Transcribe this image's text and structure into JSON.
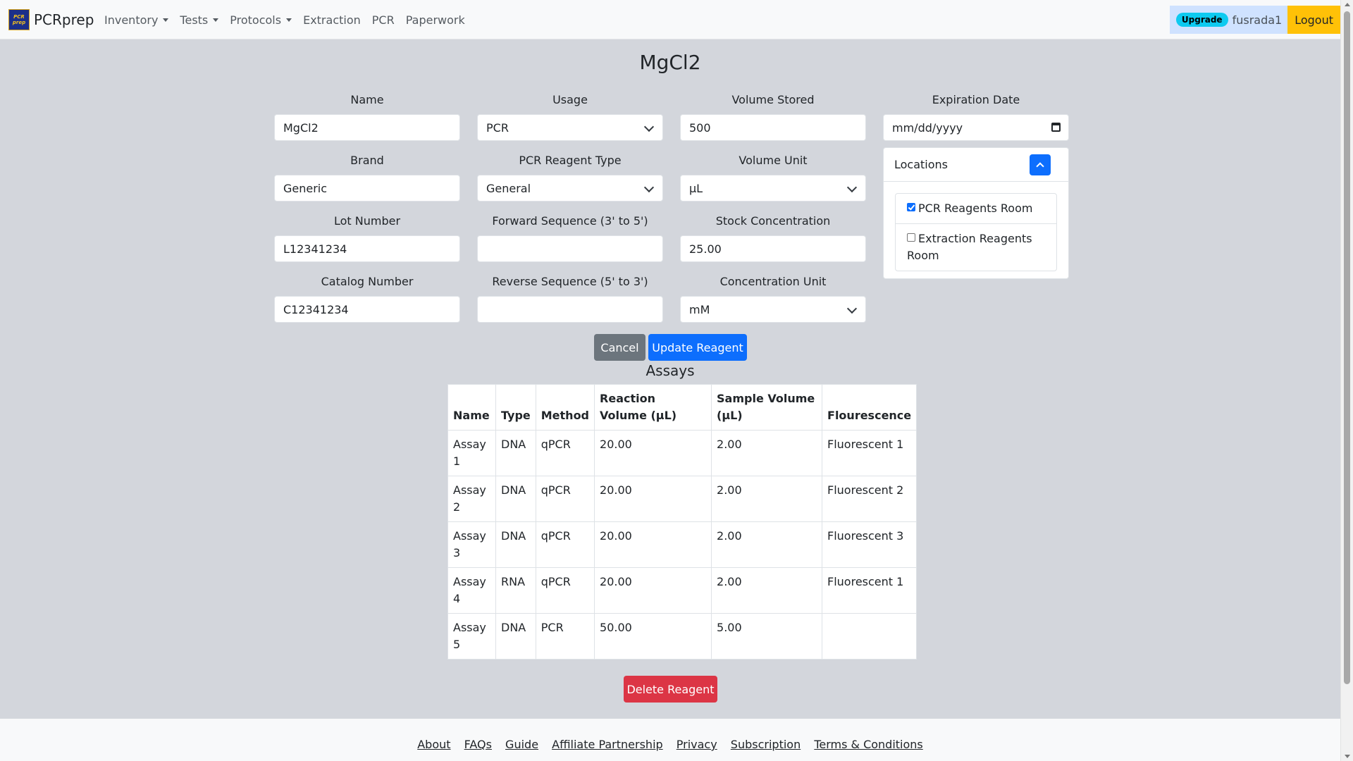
{
  "navbar": {
    "brand": "PCRprep",
    "logo_text": "PCR prep",
    "items": [
      {
        "label": "Inventory",
        "dropdown": true
      },
      {
        "label": "Tests",
        "dropdown": true
      },
      {
        "label": "Protocols",
        "dropdown": true
      },
      {
        "label": "Extraction",
        "dropdown": false
      },
      {
        "label": "PCR",
        "dropdown": false
      },
      {
        "label": "Paperwork",
        "dropdown": false
      }
    ],
    "upgrade_label": "Upgrade",
    "username": "fusrada1",
    "logout_label": "Logout"
  },
  "page": {
    "title": "MgCl2"
  },
  "form": {
    "name": {
      "label": "Name",
      "value": "MgCl2"
    },
    "brand": {
      "label": "Brand",
      "value": "Generic"
    },
    "lot_number": {
      "label": "Lot Number",
      "value": "L12341234"
    },
    "catalog_number": {
      "label": "Catalog Number",
      "value": "C12341234"
    },
    "usage": {
      "label": "Usage",
      "value": "PCR"
    },
    "pcr_reagent_type": {
      "label": "PCR Reagent Type",
      "value": "General"
    },
    "forward_sequence": {
      "label": "Forward Sequence (3' to 5')",
      "value": ""
    },
    "reverse_sequence": {
      "label": "Reverse Sequence (5' to 3')",
      "value": ""
    },
    "volume_stored": {
      "label": "Volume Stored",
      "value": "500"
    },
    "volume_unit": {
      "label": "Volume Unit",
      "value": "µL"
    },
    "stock_concentration": {
      "label": "Stock Concentration",
      "value": "25.00"
    },
    "concentration_unit": {
      "label": "Concentration Unit",
      "value": "mM"
    },
    "expiration_date": {
      "label": "Expiration Date",
      "value": "mm/dd/yyyy"
    }
  },
  "locations": {
    "title": "Locations",
    "items": [
      {
        "label": "PCR Reagents Room",
        "checked": true
      },
      {
        "label": "Extraction Reagents Room",
        "checked": false
      }
    ]
  },
  "actions": {
    "cancel_label": "Cancel",
    "update_label": "Update Reagent",
    "delete_label": "Delete Reagent"
  },
  "assays": {
    "title": "Assays",
    "columns": [
      "Name",
      "Type",
      "Method",
      "Reaction Volume (µL)",
      "Sample Volume (µL)",
      "Flourescence"
    ],
    "rows": [
      [
        "Assay 1",
        "DNA",
        "qPCR",
        "20.00",
        "2.00",
        "Fluorescent 1"
      ],
      [
        "Assay 2",
        "DNA",
        "qPCR",
        "20.00",
        "2.00",
        "Fluorescent 2"
      ],
      [
        "Assay 3",
        "DNA",
        "qPCR",
        "20.00",
        "2.00",
        "Fluorescent 3"
      ],
      [
        "Assay 4",
        "RNA",
        "qPCR",
        "20.00",
        "2.00",
        "Fluorescent 1"
      ],
      [
        "Assay 5",
        "DNA",
        "PCR",
        "50.00",
        "5.00",
        ""
      ]
    ]
  },
  "footer": {
    "links": [
      "About",
      "FAQs",
      "Guide",
      "Affiliate Partnership",
      "Privacy",
      "Subscription",
      "Terms & Conditions"
    ]
  }
}
